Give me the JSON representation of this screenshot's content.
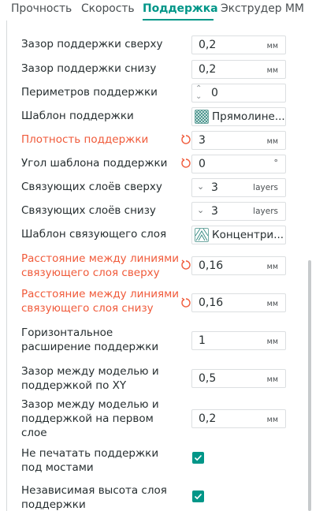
{
  "tabs": [
    {
      "label": "Прочность",
      "active": false
    },
    {
      "label": "Скорость",
      "active": false
    },
    {
      "label": "Поддержка",
      "active": true
    },
    {
      "label": "Экструдер MM",
      "active": false
    }
  ],
  "colors": {
    "accent": "#009688",
    "modified": "#f05a3a"
  },
  "settings": {
    "top_z_distance": {
      "label": "Зазор поддержки сверху",
      "value": "0,2",
      "unit": "мм"
    },
    "bottom_z_distance": {
      "label": "Зазор поддержки снизу",
      "value": "0,2",
      "unit": "мм"
    },
    "wall_loops": {
      "label": "Периметров поддержки",
      "value": "0"
    },
    "base_pattern": {
      "label": "Шаблон поддержки",
      "value": "Прямолине..."
    },
    "density": {
      "label": "Плотность поддержки",
      "value": "3",
      "unit": "мм",
      "modified": true
    },
    "pattern_angle": {
      "label": "Угол шаблона поддержки",
      "value": "0",
      "unit": "°"
    },
    "top_interface_layers": {
      "label": "Связующих слоёв сверху",
      "value": "3",
      "unit": "layers"
    },
    "bottom_interface_layers": {
      "label": "Связующих слоёв снизу",
      "value": "3",
      "unit": "layers"
    },
    "interface_pattern": {
      "label": "Шаблон связующего слоя",
      "value": "Концентри..."
    },
    "top_interface_spacing": {
      "label_line1": "Расстояние между линиями",
      "label_line2": "связующего слоя сверху",
      "value": "0,16",
      "unit": "мм",
      "modified": true
    },
    "bottom_interface_spacing": {
      "label_line1": "Расстояние между линиями",
      "label_line2": "связующего слоя снизу",
      "value": "0,16",
      "unit": "мм",
      "modified": true
    },
    "expansion": {
      "label_line1": "Горизонтальное",
      "label_line2": "расширение поддержки",
      "value": "1",
      "unit": "мм"
    },
    "object_xy_distance": {
      "label_line1": "Зазор между моделью и",
      "label_line2": "поддержкой по XY",
      "value": "0,5",
      "unit": "мм"
    },
    "first_layer_gap": {
      "label_line1": "Зазор между моделью и",
      "label_line2": "поддержкой на первом",
      "label_line3": "слое",
      "value": "0,2",
      "unit": "мм"
    },
    "dont_support_bridges": {
      "label_line1": "Не печатать поддержки",
      "label_line2": "под мостами",
      "checked": true
    },
    "independent_layer_height": {
      "label_line1": "Независимая высота слоя",
      "label_line2": "поддержки",
      "checked": true
    }
  }
}
